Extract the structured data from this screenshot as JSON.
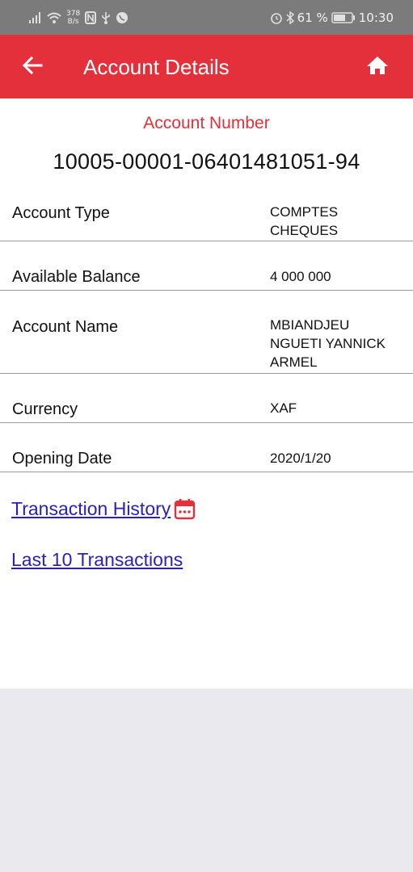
{
  "status_bar": {
    "speed_value": "378",
    "speed_unit": "B/s",
    "battery": "61 %",
    "time": "10:30"
  },
  "app_bar": {
    "title": "Account Details",
    "color": "#e3303b"
  },
  "account": {
    "number_label": "Account Number",
    "number": "10005-00001-06401481051-94"
  },
  "details": [
    {
      "label": "Account Type",
      "value": "COMPTES\nCHEQUES"
    },
    {
      "label": "Available Balance",
      "value": "4 000 000"
    },
    {
      "label": "Account Name",
      "value": "MBIANDJEU\nNGUETI YANNICK\nARMEL"
    },
    {
      "label": "Currency",
      "value": "XAF"
    },
    {
      "label": "Opening Date",
      "value": "2020/1/20"
    }
  ],
  "links": {
    "transaction_history": "Transaction History",
    "last_10": "Last 10 Transactions"
  },
  "icons": {
    "back": "arrow-left-icon",
    "home": "home-icon",
    "calendar": "calendar-icon"
  }
}
